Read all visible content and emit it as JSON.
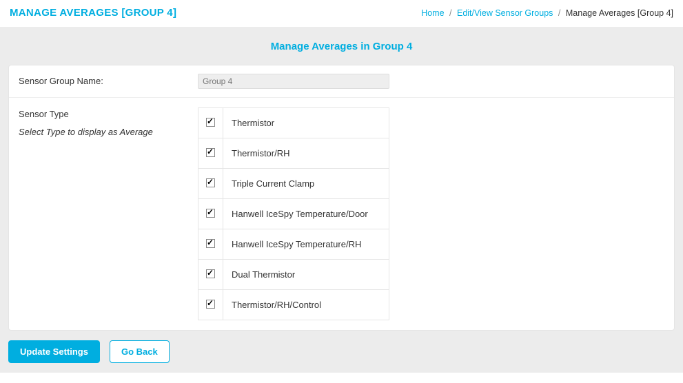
{
  "header": {
    "title": "MANAGE AVERAGES [GROUP 4]"
  },
  "breadcrumb": {
    "home": "Home",
    "mid": "Edit/View Sensor Groups",
    "current": "Manage Averages [Group 4]"
  },
  "subtitle": "Manage Averages in Group 4",
  "form": {
    "group_name_label": "Sensor Group Name:",
    "group_name_value": "Group 4",
    "sensor_type_label": "Sensor Type",
    "sensor_type_sub": "Select Type to display as Average"
  },
  "sensor_types": [
    {
      "label": "Thermistor",
      "checked": true
    },
    {
      "label": "Thermistor/RH",
      "checked": true
    },
    {
      "label": "Triple Current Clamp",
      "checked": true
    },
    {
      "label": "Hanwell IceSpy Temperature/Door",
      "checked": true
    },
    {
      "label": "Hanwell IceSpy Temperature/RH",
      "checked": true
    },
    {
      "label": "Dual Thermistor",
      "checked": true
    },
    {
      "label": "Thermistor/RH/Control",
      "checked": true
    }
  ],
  "buttons": {
    "update": "Update Settings",
    "back": "Go Back"
  }
}
